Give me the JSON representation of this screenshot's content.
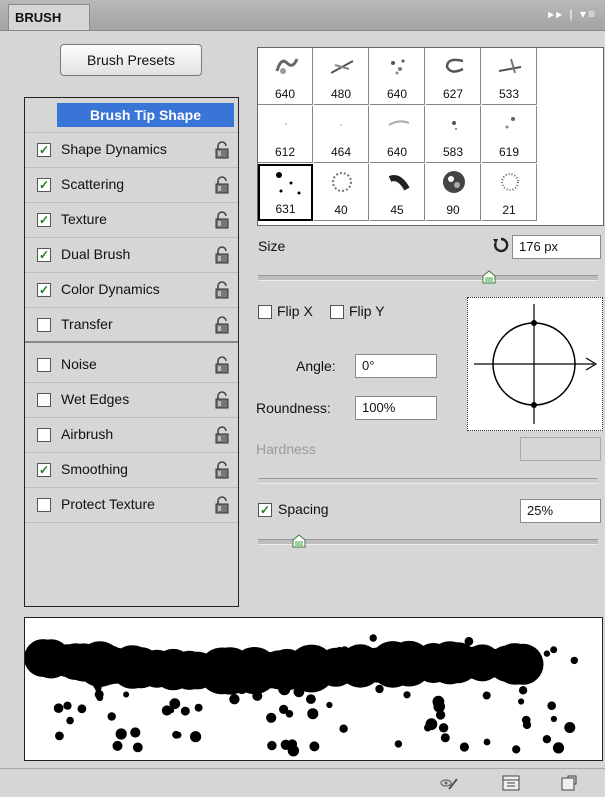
{
  "panel": {
    "tab_label": "BRUSH",
    "titlebar_icons": "▸▸ | ▾≡",
    "presets_button": "Brush Presets"
  },
  "options": [
    {
      "label": "Brush Tip Shape",
      "selected": true,
      "has_checkbox": false,
      "checked": false,
      "lock": false
    },
    {
      "label": "Shape Dynamics",
      "checked": true,
      "lock": true
    },
    {
      "label": "Scattering",
      "checked": true,
      "lock": true
    },
    {
      "label": "Texture",
      "checked": true,
      "lock": true
    },
    {
      "label": "Dual Brush",
      "checked": true,
      "lock": true
    },
    {
      "label": "Color Dynamics",
      "checked": true,
      "lock": true
    },
    {
      "label": "Transfer",
      "checked": false,
      "lock": true
    },
    {
      "label": "Noise",
      "checked": false,
      "lock": true
    },
    {
      "label": "Wet Edges",
      "checked": false,
      "lock": true
    },
    {
      "label": "Airbrush",
      "checked": false,
      "lock": true
    },
    {
      "label": "Smoothing",
      "checked": true,
      "lock": true
    },
    {
      "label": "Protect Texture",
      "checked": false,
      "lock": true
    }
  ],
  "brush_tips": [
    {
      "size": "640"
    },
    {
      "size": "480"
    },
    {
      "size": "640"
    },
    {
      "size": "627"
    },
    {
      "size": "533"
    },
    {
      "size": "612"
    },
    {
      "size": "464"
    },
    {
      "size": "640"
    },
    {
      "size": "583"
    },
    {
      "size": "619"
    },
    {
      "size": "631",
      "selected": true
    },
    {
      "size": "40"
    },
    {
      "size": "45"
    },
    {
      "size": "90"
    },
    {
      "size": "21"
    }
  ],
  "size": {
    "label": "Size",
    "value": "176 px",
    "slider_fraction": 0.68
  },
  "flip_x": {
    "label": "Flip X",
    "checked": false
  },
  "flip_y": {
    "label": "Flip Y",
    "checked": false
  },
  "angle": {
    "label": "Angle:",
    "value": "0°"
  },
  "roundness": {
    "label": "Roundness:",
    "value": "100%"
  },
  "hardness": {
    "label": "Hardness",
    "value": ""
  },
  "spacing": {
    "label": "Spacing",
    "checked": true,
    "value": "25%",
    "slider_fraction": 0.12
  },
  "colors": {
    "accent": "#3875d7",
    "panel": "#d6d6d6"
  }
}
